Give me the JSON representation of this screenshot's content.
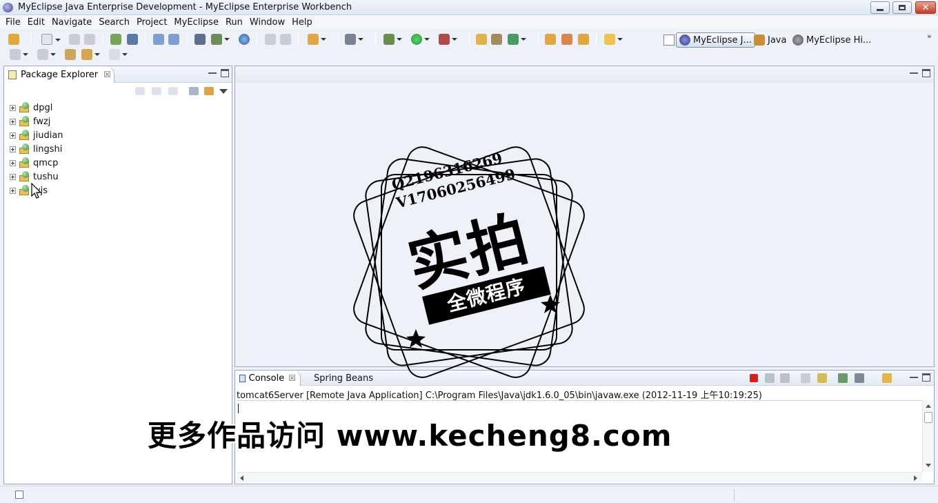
{
  "window": {
    "title": "MyEclipse Java Enterprise Development - MyEclipse Enterprise Workbench",
    "close_glyph": "✕"
  },
  "menu": [
    "File",
    "Edit",
    "Navigate",
    "Search",
    "Project",
    "MyEclipse",
    "Run",
    "Window",
    "Help"
  ],
  "perspectives": {
    "items": [
      {
        "label": "MyEclipse J...",
        "active": true,
        "icon": "myeclipse-icon"
      },
      {
        "label": "Java",
        "active": false,
        "icon": "java-icon"
      },
      {
        "label": "MyEclipse Hi...",
        "active": false,
        "icon": "hibernate-icon"
      }
    ],
    "more_glyph": "»"
  },
  "package_explorer": {
    "title": "Package Explorer",
    "close_glyph": "☒",
    "projects": [
      "dpgl",
      "fwzj",
      "jiudian",
      "lingshi",
      "qmcp",
      "tushu",
      "wjs"
    ]
  },
  "console": {
    "tabs": [
      {
        "label": "Console",
        "active": true
      },
      {
        "label": "Spring Beans",
        "active": false
      }
    ],
    "close_glyph": "☒",
    "description": "tomcat6Server [Remote Java Application] C:\\Program Files\\Java\\jdk1.6.0_05\\bin\\javaw.exe (2012-11-19 上午10:19:25)"
  },
  "watermark": {
    "line1": "Q2196316269",
    "line2": "V17060256499",
    "big_text": "实拍",
    "ribbon_text": "全微程序"
  },
  "overlay": {
    "banner": "更多作品访问 www.kecheng8.com"
  },
  "colors": {
    "accent": "#3a5f9e",
    "stop_red": "#d32020",
    "run_green": "#1f9b3a"
  }
}
